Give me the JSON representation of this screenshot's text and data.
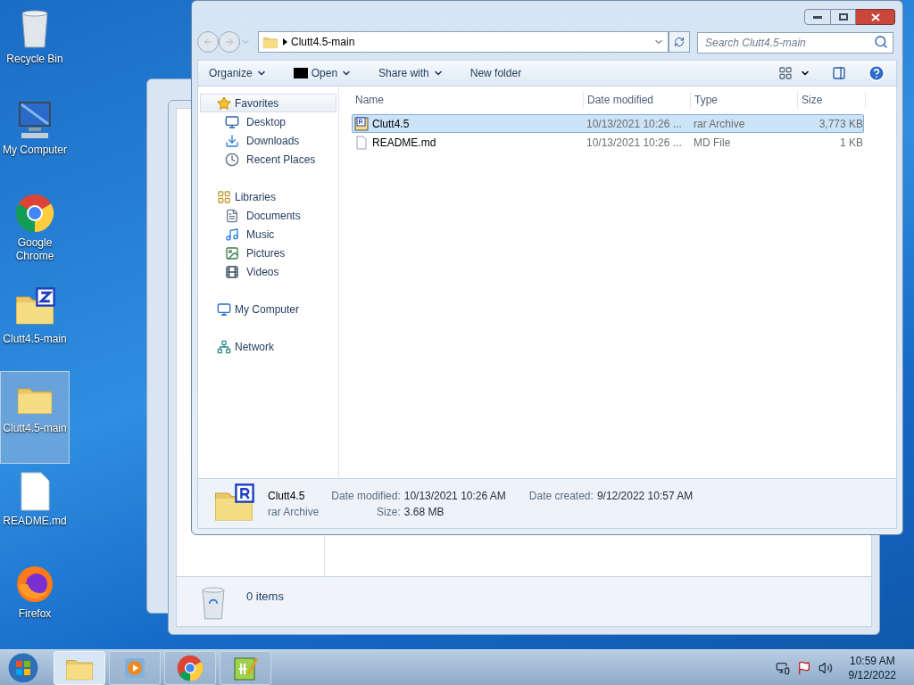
{
  "desktop_icons": [
    {
      "label": "Recycle Bin",
      "kind": "recycle",
      "selected": false
    },
    {
      "label": "My Computer",
      "kind": "computer",
      "selected": false
    },
    {
      "label": "Google Chrome",
      "kind": "chrome",
      "selected": false
    },
    {
      "label": "Clutt4.5-main",
      "kind": "zipfolder",
      "selected": false
    },
    {
      "label": "Clutt4.5-main",
      "kind": "folder",
      "selected": true
    },
    {
      "label": "README.md",
      "kind": "file",
      "selected": false
    },
    {
      "label": "Firefox",
      "kind": "firefox",
      "selected": false
    }
  ],
  "back_window": {
    "status": "0 items"
  },
  "explorer": {
    "address": "Clutt4.5-main",
    "search_placeholder": "Search Clutt4.5-main",
    "toolbar": [
      {
        "label": "Organize",
        "kind": "plain",
        "dropdown": true
      },
      {
        "label": "Open",
        "kind": "sevenzip",
        "dropdown": true
      },
      {
        "label": "Share with",
        "kind": "plain",
        "dropdown": true
      },
      {
        "label": "New folder",
        "kind": "plain",
        "dropdown": false
      }
    ],
    "nav": [
      {
        "label": "Favorites",
        "kind": "star",
        "selected": true,
        "children": [
          {
            "label": "Desktop",
            "kind": "desktop"
          },
          {
            "label": "Downloads",
            "kind": "downloads"
          },
          {
            "label": "Recent Places",
            "kind": "recent"
          }
        ]
      },
      {
        "label": "Libraries",
        "kind": "libraries",
        "selected": false,
        "children": [
          {
            "label": "Documents",
            "kind": "documents"
          },
          {
            "label": "Music",
            "kind": "music"
          },
          {
            "label": "Pictures",
            "kind": "pictures"
          },
          {
            "label": "Videos",
            "kind": "videos"
          }
        ]
      },
      {
        "label": "My Computer",
        "kind": "computer",
        "selected": false
      },
      {
        "label": "Network",
        "kind": "network",
        "selected": false
      }
    ],
    "columns": [
      "Name",
      "Date modified",
      "Type",
      "Size"
    ],
    "rows": [
      {
        "name": "Clutt4.5",
        "date": "10/13/2021 10:26 ...",
        "type": "rar Archive",
        "size": "3,773 KB",
        "kind": "rar",
        "selected": true
      },
      {
        "name": "README.md",
        "date": "10/13/2021 10:26 ...",
        "type": "MD File",
        "size": "1 KB",
        "kind": "text",
        "selected": false
      }
    ],
    "details": {
      "name": "Clutt4.5",
      "type": "rar Archive",
      "fields": [
        {
          "label": "Date modified:",
          "value": "10/13/2021 10:26 AM"
        },
        {
          "label": "Date created:",
          "value": "9/12/2022 10:57 AM"
        },
        {
          "label": "Size:",
          "value": "3.68 MB"
        }
      ]
    }
  },
  "taskbar": {
    "apps": [
      {
        "kind": "explorer",
        "selected": true
      },
      {
        "kind": "media",
        "selected": false
      },
      {
        "kind": "chrome",
        "selected": false
      },
      {
        "kind": "notepad",
        "selected": false
      }
    ],
    "time": "10:59 AM",
    "date": "9/12/2022"
  }
}
